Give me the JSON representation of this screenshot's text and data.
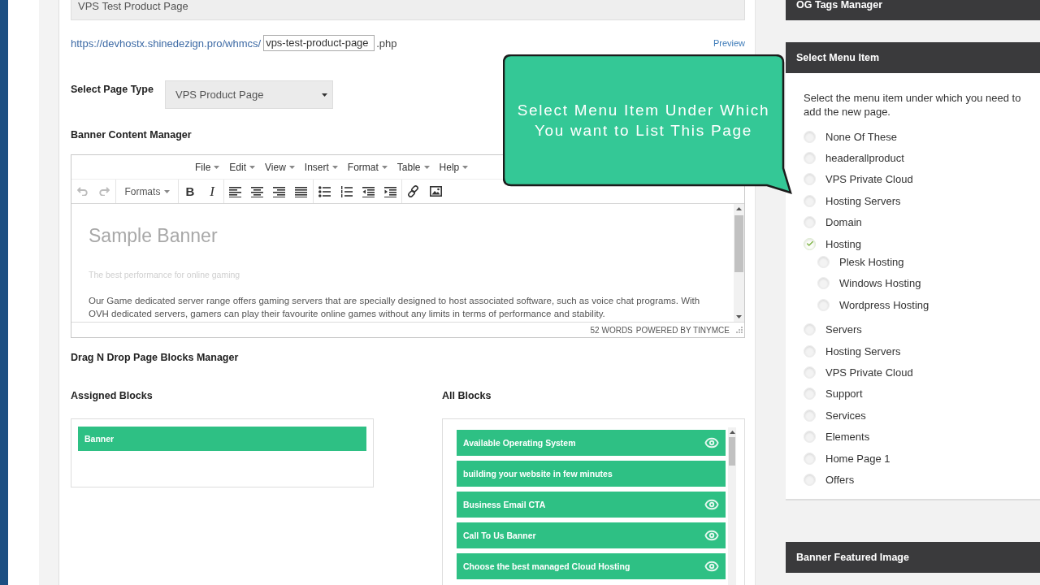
{
  "page_title_field": {
    "value": "VPS Test Product Page"
  },
  "page_url": {
    "base": "https://devhostx.shinedezign.pro/whmcs/",
    "slug": "vps-test-product-page",
    "suffix": ".php",
    "preview_link": "Preview"
  },
  "page_type": {
    "label": "Select Page Type",
    "value": "VPS Product Page"
  },
  "banner_editor": {
    "heading": "Banner Content Manager",
    "menus": [
      "File",
      "Edit",
      "View",
      "Insert",
      "Format",
      "Table",
      "Help"
    ],
    "toolbar": [
      {
        "items": [
          {
            "kind": "undo",
            "disabled": true
          },
          {
            "kind": "redo",
            "disabled": true
          }
        ]
      },
      {
        "items": [
          {
            "kind": "formats",
            "label": "Formats",
            "disabled": false
          }
        ]
      },
      {
        "items": [
          {
            "kind": "bold",
            "label": "B",
            "disabled": false
          },
          {
            "kind": "italic",
            "label": "I",
            "disabled": false
          }
        ]
      },
      {
        "items": [
          {
            "kind": "align-left",
            "disabled": false
          },
          {
            "kind": "align-center",
            "disabled": false
          },
          {
            "kind": "align-right",
            "disabled": false
          },
          {
            "kind": "align-justify",
            "disabled": false
          }
        ]
      },
      {
        "items": [
          {
            "kind": "bullet-list",
            "disabled": false
          },
          {
            "kind": "numbered-list",
            "disabled": false
          },
          {
            "kind": "outdent",
            "disabled": false
          },
          {
            "kind": "indent",
            "disabled": false
          }
        ]
      },
      {
        "items": [
          {
            "kind": "link",
            "disabled": false
          },
          {
            "kind": "image",
            "disabled": false
          }
        ]
      }
    ],
    "content": {
      "title": "Sample Banner",
      "subtitle": "The best performance for online gaming",
      "paragraph": "Our Game dedicated server range offers gaming servers that are specially designed to host associated software, such as voice chat programs. With OVH dedicated servers, gamers can play their favourite online games without any limits in terms of performance and stability."
    },
    "word_count": "52 WORDS",
    "branding": "POWERED BY TINYMCE"
  },
  "blocks_manager": {
    "heading": "Drag N Drop Page Blocks Manager",
    "assigned": {
      "title": "Assigned Blocks",
      "blocks": [
        {
          "label": "Banner",
          "preview": false
        }
      ]
    },
    "all": {
      "title": "All Blocks",
      "blocks": [
        {
          "label": "Available Operating System",
          "preview": true
        },
        {
          "label": "building your website in few minutes",
          "preview": false
        },
        {
          "label": "Business Email CTA",
          "preview": true
        },
        {
          "label": "Call To Us Banner",
          "preview": true
        },
        {
          "label": "Choose the best managed Cloud Hosting",
          "preview": true
        }
      ]
    }
  },
  "callout": {
    "text": "Select Menu Item Under Which You want to List This Page"
  },
  "sidebar": {
    "panels": [
      {
        "title": "OG Tags Manager"
      },
      {
        "title": "Select Menu Item",
        "description": "Select the menu item under which you need to add the new page.",
        "items": [
          {
            "label": "None Of These",
            "selected": false
          },
          {
            "label": "headerallproduct",
            "selected": false
          },
          {
            "label": "VPS Private Cloud",
            "selected": false
          },
          {
            "label": "Hosting Servers",
            "selected": false
          },
          {
            "label": "Domain",
            "selected": false
          },
          {
            "label": "Hosting",
            "selected": true,
            "children": [
              {
                "label": "Plesk Hosting",
                "selected": false
              },
              {
                "label": "Windows Hosting",
                "selected": false
              },
              {
                "label": "Wordpress Hosting",
                "selected": false
              }
            ]
          },
          {
            "label": "Servers",
            "selected": false
          },
          {
            "label": "Hosting Servers",
            "selected": false
          },
          {
            "label": "VPS Private Cloud",
            "selected": false
          },
          {
            "label": "Support",
            "selected": false
          },
          {
            "label": "Services",
            "selected": false
          },
          {
            "label": "Elements",
            "selected": false
          },
          {
            "label": "Home Page 1",
            "selected": false
          },
          {
            "label": "Offers",
            "selected": false
          }
        ]
      },
      {
        "title": "Banner Featured Image"
      }
    ]
  }
}
